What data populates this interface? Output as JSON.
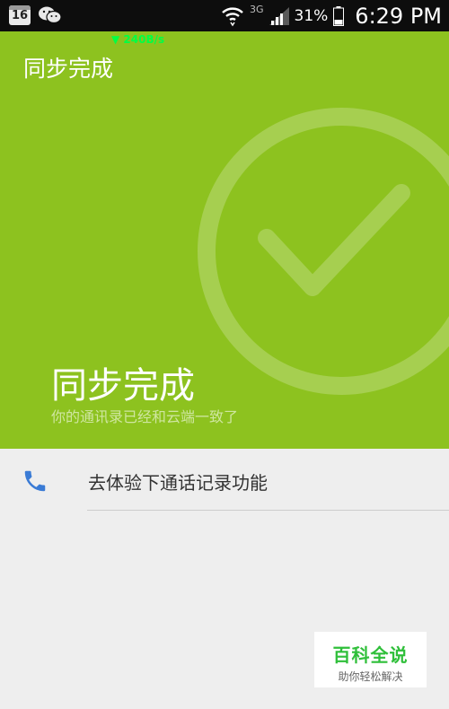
{
  "status_bar": {
    "calendar_day": "16",
    "network": "3G",
    "battery": "31%",
    "time": "6:29 PM",
    "speed": "240B/s"
  },
  "header": {
    "title": "同步完成"
  },
  "hero": {
    "title": "同步完成",
    "subtitle": "你的通讯录已经和云端一致了",
    "color": "#8dc21f"
  },
  "actions": [
    {
      "icon": "phone-icon",
      "label": "去体验下通话记录功能",
      "icon_color": "#3a7bd5"
    }
  ],
  "watermark": {
    "brand": "百科全说",
    "slogan": "助你轻松解决"
  }
}
